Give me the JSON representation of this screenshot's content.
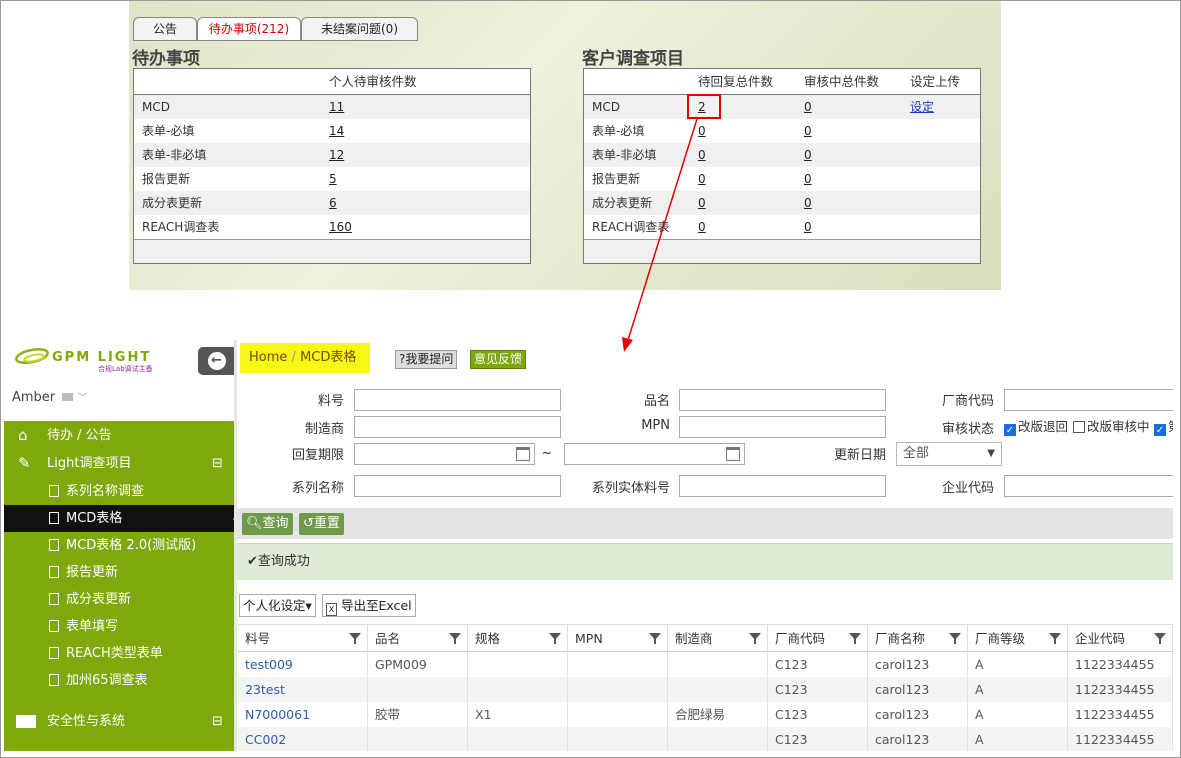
{
  "top_panel": {
    "tabs": [
      {
        "label": "公告"
      },
      {
        "label": "待办事项(212)",
        "active": true
      },
      {
        "label": "未结案问题(0)"
      }
    ],
    "todo": {
      "title": "待办事项",
      "column": "个人待审核件数",
      "rows": [
        {
          "name": "MCD",
          "count": "11"
        },
        {
          "name": "表单-必填",
          "count": "14"
        },
        {
          "name": "表单-非必填",
          "count": "12"
        },
        {
          "name": "报告更新",
          "count": "5"
        },
        {
          "name": "成分表更新",
          "count": "6"
        },
        {
          "name": "REACH调查表",
          "count": "160"
        }
      ]
    },
    "survey": {
      "title": "客户调查项目",
      "columns": [
        "待回复总件数",
        "审核中总件数",
        "设定上传"
      ],
      "rows": [
        {
          "name": "MCD",
          "pending": "2",
          "review": "0",
          "setting": "设定"
        },
        {
          "name": "表单-必填",
          "pending": "0",
          "review": "0",
          "setting": ""
        },
        {
          "name": "表单-非必填",
          "pending": "0",
          "review": "0",
          "setting": ""
        },
        {
          "name": "报告更新",
          "pending": "0",
          "review": "0",
          "setting": ""
        },
        {
          "name": "成分表更新",
          "pending": "0",
          "review": "0",
          "setting": ""
        },
        {
          "name": "REACH调查表",
          "pending": "0",
          "review": "0",
          "setting": ""
        }
      ]
    }
  },
  "header": {
    "logo_text": "GPM LIGHT",
    "logo_sub": "合规Lab调试主备",
    "breadcrumb_home": "Home",
    "breadcrumb_sep": "/",
    "breadcrumb_current": "MCD表格",
    "ask_button": "?我要提问",
    "feedback_button": "意见反馈",
    "user": "Amber"
  },
  "sidebar": {
    "items": [
      {
        "label": "待办 / 公告",
        "icon": "home-icon",
        "level": 0
      },
      {
        "label": "Light调查项目",
        "icon": "edit-icon",
        "level": 0,
        "toggle": "⊟"
      },
      {
        "label": "系列名称调查",
        "icon": "document-icon",
        "level": 1
      },
      {
        "label": "MCD表格",
        "icon": "document-icon",
        "level": 1,
        "active": true
      },
      {
        "label": "MCD表格 2.0(测试版)",
        "icon": "document-icon",
        "level": 1
      },
      {
        "label": "报告更新",
        "icon": "document-icon",
        "level": 1
      },
      {
        "label": "成分表更新",
        "icon": "document-icon",
        "level": 1
      },
      {
        "label": "表单填写",
        "icon": "document-icon",
        "level": 1
      },
      {
        "label": "REACH类型表单",
        "icon": "document-icon",
        "level": 1
      },
      {
        "label": "加州65调查表",
        "icon": "document-icon",
        "level": 1
      },
      {
        "label": "安全性与系统",
        "icon": "monitor-icon",
        "level": 0,
        "toggle": "⊟"
      }
    ]
  },
  "form": {
    "part_no": "料号",
    "product_name": "品名",
    "vendor_code": "厂商代码",
    "manufacturer": "制造商",
    "mpn": "MPN",
    "audit_status": "审核状态",
    "status_options": [
      {
        "label": "改版退回",
        "checked": true
      },
      {
        "label": "改版审核中",
        "checked": false
      },
      {
        "label": "第",
        "checked": true
      }
    ],
    "reply_deadline": "回复期限",
    "range_sep": "~",
    "update_date": "更新日期",
    "update_date_value": "全部",
    "series_name": "系列名称",
    "series_entity_part": "系列实体料号",
    "company_code": "企业代码",
    "query_button": "查询",
    "reset_button": "重置",
    "success_message": "查询成功",
    "personalize_button": "个人化设定▾",
    "export_button": "导出至Excel"
  },
  "grid": {
    "columns": [
      "料号",
      "品名",
      "规格",
      "MPN",
      "制造商",
      "厂商代码",
      "厂商名称",
      "厂商等级",
      "企业代码"
    ],
    "rows": [
      [
        "test009",
        "GPM009",
        "",
        "",
        "",
        "C123",
        "carol123",
        "A",
        "1122334455"
      ],
      [
        "23test",
        "",
        "",
        "",
        "",
        "C123",
        "carol123",
        "A",
        "1122334455"
      ],
      [
        "N7000061",
        "胶带",
        "X1",
        "",
        "合肥绿易",
        "C123",
        "carol123",
        "A",
        "1122334455"
      ],
      [
        "CC002",
        "",
        "",
        "",
        "",
        "C123",
        "carol123",
        "A",
        "1122334455"
      ]
    ]
  },
  "colors": {
    "sidebar_green": "#7ea80b",
    "breadcrumb_yellow": "#f7f716",
    "highlight_red": "#e00000",
    "link_blue": "#2a5ea8"
  }
}
